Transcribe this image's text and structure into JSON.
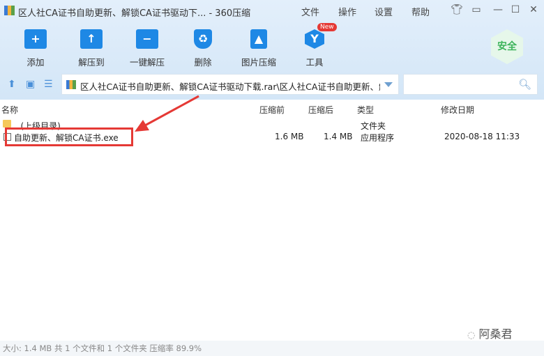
{
  "window": {
    "title": "区人社CA证书自助更新、解锁CA证书驱动下... - 360压缩"
  },
  "menu": [
    "文件",
    "操作",
    "设置",
    "帮助"
  ],
  "toolbar": [
    {
      "label": "添加",
      "icon": "+"
    },
    {
      "label": "解压到",
      "icon": "↑"
    },
    {
      "label": "一键解压",
      "icon": "−"
    },
    {
      "label": "删除",
      "icon": "♻"
    },
    {
      "label": "图片压缩",
      "icon": "▲"
    },
    {
      "label": "工具",
      "icon": "Y"
    }
  ],
  "new_badge": "New",
  "safe_badge": "安全",
  "address": {
    "path": "区人社CA证书自助更新、解锁CA证书驱动下载.rar\\区人社CA证书自助更新、解锁",
    "search_placeholder": ""
  },
  "columns": [
    "名称",
    "压缩前",
    "压缩后",
    "类型",
    "修改日期"
  ],
  "rows": [
    {
      "name": ".. (上级目录)",
      "before": "",
      "after": "",
      "type": "文件夹",
      "date": ""
    },
    {
      "name": "自助更新、解锁CA证书.exe",
      "before": "1.6 MB",
      "after": "1.4 MB",
      "type": "应用程序",
      "date": "2020-08-18 11:33"
    }
  ],
  "status": "大小: 1.4 MB 共 1 个文件和 1 个文件夹 压缩率 89.9%",
  "watermark": "阿桑君"
}
